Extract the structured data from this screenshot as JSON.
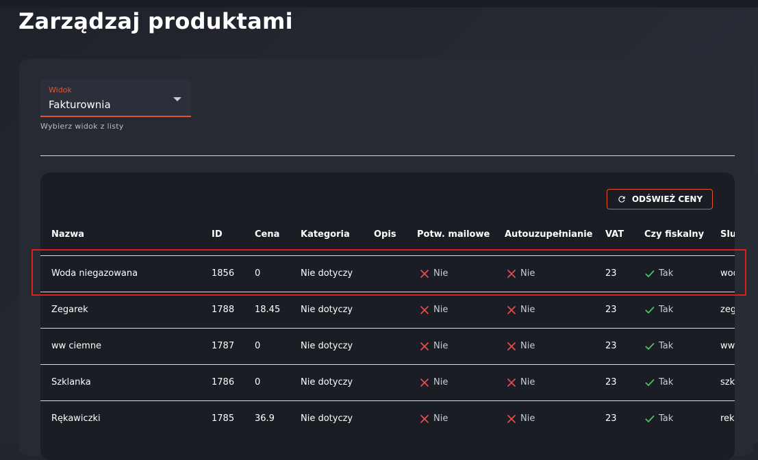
{
  "page": {
    "title": "Zarządzaj produktami"
  },
  "view_select": {
    "label": "Widok",
    "value": "Fakturownia",
    "hint": "Wybierz widok z listy"
  },
  "refresh_button": {
    "label": "ODŚWIEŻ CENY"
  },
  "table": {
    "columns": [
      "Nazwa",
      "ID",
      "Cena",
      "Kategoria",
      "Opis",
      "Potw. mailowe",
      "Autouzupełnianie",
      "VAT",
      "Czy fiskalny",
      "Slu"
    ],
    "rows": [
      {
        "name": "Woda niegazowana",
        "id": "1856",
        "price": "0",
        "category": "Nie dotyczy",
        "desc": "",
        "mail": "Nie",
        "auto": "Nie",
        "vat": "23",
        "fiscal": "Tak",
        "slug": "wod"
      },
      {
        "name": "Zegarek",
        "id": "1788",
        "price": "18.45",
        "category": "Nie dotyczy",
        "desc": "",
        "mail": "Nie",
        "auto": "Nie",
        "vat": "23",
        "fiscal": "Tak",
        "slug": "zeg"
      },
      {
        "name": "ww ciemne",
        "id": "1787",
        "price": "0",
        "category": "Nie dotyczy",
        "desc": "",
        "mail": "Nie",
        "auto": "Nie",
        "vat": "23",
        "fiscal": "Tak",
        "slug": "ww"
      },
      {
        "name": "Szklanka",
        "id": "1786",
        "price": "0",
        "category": "Nie dotyczy",
        "desc": "",
        "mail": "Nie",
        "auto": "Nie",
        "vat": "23",
        "fiscal": "Tak",
        "slug": "szk"
      },
      {
        "name": "Rękawiczki",
        "id": "1785",
        "price": "36.9",
        "category": "Nie dotyczy",
        "desc": "",
        "mail": "Nie",
        "auto": "Nie",
        "vat": "23",
        "fiscal": "Tak",
        "slug": "rek"
      }
    ]
  },
  "colors": {
    "accent": "#e8532b",
    "no": "#e84b4b",
    "yes": "#4cc36a",
    "highlight": "#e01e1e"
  },
  "icons": {
    "refresh": "refresh-icon",
    "no": "close-icon",
    "yes": "check-icon",
    "dropdown": "chevron-down-icon"
  }
}
